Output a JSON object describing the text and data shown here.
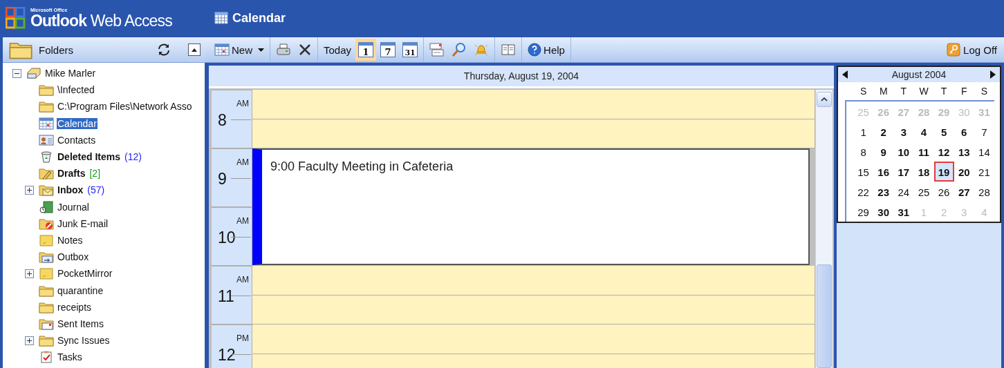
{
  "logo": {
    "suite": "Microsoft Office",
    "product": "**Outlook** Web Access"
  },
  "title": "Calendar",
  "folders": {
    "title": "Folders",
    "tree": [
      {
        "name": "Mike Marler",
        "kind": "mailbox",
        "expanded": true,
        "selected": false,
        "unread": false,
        "children": [
          {
            "name": "\\Infected",
            "kind": "folder",
            "selected": false,
            "unread": false
          },
          {
            "name": "C:\\Program Files\\Network Asso",
            "kind": "folder",
            "selected": false,
            "unread": false
          },
          {
            "name": "Calendar",
            "kind": "calendar",
            "selected": true,
            "unread": false
          },
          {
            "name": "Contacts",
            "kind": "contacts",
            "selected": false,
            "unread": false
          },
          {
            "name": "Deleted Items",
            "kind": "trash",
            "selected": false,
            "unread": true,
            "count": "(12)",
            "color": "#2020ff"
          },
          {
            "name": "Drafts",
            "kind": "drafts",
            "selected": false,
            "unread": true,
            "count": "[2]",
            "color": "#1a9a1a"
          },
          {
            "name": "Inbox",
            "kind": "inbox",
            "selected": false,
            "unread": true,
            "count": "(57)",
            "color": "#2020ff",
            "expanded": false
          },
          {
            "name": "Journal",
            "kind": "journal",
            "selected": false,
            "unread": false
          },
          {
            "name": "Junk E-mail",
            "kind": "junk",
            "selected": false,
            "unread": false
          },
          {
            "name": "Notes",
            "kind": "notes",
            "selected": false,
            "unread": false
          },
          {
            "name": "Outbox",
            "kind": "outbox",
            "selected": false,
            "unread": false
          },
          {
            "name": "PocketMirror",
            "kind": "notes",
            "selected": false,
            "unread": false,
            "expanded": false
          },
          {
            "name": "quarantine",
            "kind": "folder",
            "selected": false,
            "unread": false
          },
          {
            "name": "receipts",
            "kind": "folder",
            "selected": false,
            "unread": false
          },
          {
            "name": "Sent Items",
            "kind": "sent",
            "selected": false,
            "unread": false
          },
          {
            "name": "Sync Issues",
            "kind": "folder",
            "selected": false,
            "unread": false,
            "expanded": false
          },
          {
            "name": "Tasks",
            "kind": "tasks",
            "selected": false,
            "unread": false
          }
        ]
      }
    ]
  },
  "toolbar": {
    "groups": [
      [
        {
          "kind": "new",
          "label": "New"
        }
      ],
      [
        {
          "kind": "print"
        },
        {
          "kind": "delete"
        }
      ],
      [
        {
          "kind": "today",
          "label": "Today"
        },
        {
          "kind": "day",
          "label": "1",
          "selected": true
        },
        {
          "kind": "week",
          "label": "7",
          "selected": false
        },
        {
          "kind": "month",
          "label": "31",
          "selected": false
        }
      ],
      [
        {
          "kind": "options"
        },
        {
          "kind": "find"
        },
        {
          "kind": "reminders"
        }
      ],
      [
        {
          "kind": "addressbook"
        }
      ],
      [
        {
          "kind": "help",
          "label": "Help"
        }
      ]
    ],
    "logoff": "Log Off"
  },
  "day_view": {
    "date": "Thursday, August 19, 2004",
    "hours": [
      {
        "hour": "8",
        "period": "AM",
        "busy": false
      },
      {
        "hour": "9",
        "period": "AM",
        "busy": true,
        "appointment": "9:00 Faculty Meeting in Cafeteria"
      },
      {
        "hour": "10",
        "period": "AM",
        "busy": true
      },
      {
        "hour": "11",
        "period": "AM",
        "busy": false
      },
      {
        "hour": "12",
        "period": "PM",
        "busy": false
      }
    ]
  },
  "mini_calendar": {
    "month": "August 2004",
    "weekdays": [
      "S",
      "M",
      "T",
      "W",
      "T",
      "F",
      "S"
    ],
    "weeks": [
      [
        {
          "day": "25",
          "other_month": true,
          "has_items": false,
          "selected": false
        },
        {
          "day": "26",
          "other_month": true,
          "has_items": true,
          "selected": false
        },
        {
          "day": "27",
          "other_month": true,
          "has_items": true,
          "selected": false
        },
        {
          "day": "28",
          "other_month": true,
          "has_items": true,
          "selected": false
        },
        {
          "day": "29",
          "other_month": true,
          "has_items": true,
          "selected": false
        },
        {
          "day": "30",
          "other_month": true,
          "has_items": false,
          "selected": false
        },
        {
          "day": "31",
          "other_month": true,
          "has_items": true,
          "selected": false
        }
      ],
      [
        {
          "day": "1",
          "other_month": false,
          "has_items": false,
          "selected": false
        },
        {
          "day": "2",
          "other_month": false,
          "has_items": true,
          "selected": false
        },
        {
          "day": "3",
          "other_month": false,
          "has_items": true,
          "selected": false
        },
        {
          "day": "4",
          "other_month": false,
          "has_items": true,
          "selected": false
        },
        {
          "day": "5",
          "other_month": false,
          "has_items": true,
          "selected": false
        },
        {
          "day": "6",
          "other_month": false,
          "has_items": true,
          "selected": false
        },
        {
          "day": "7",
          "other_month": false,
          "has_items": false,
          "selected": false
        }
      ],
      [
        {
          "day": "8",
          "other_month": false,
          "has_items": false,
          "selected": false
        },
        {
          "day": "9",
          "other_month": false,
          "has_items": true,
          "selected": false
        },
        {
          "day": "10",
          "other_month": false,
          "has_items": true,
          "selected": false
        },
        {
          "day": "11",
          "other_month": false,
          "has_items": true,
          "selected": false
        },
        {
          "day": "12",
          "other_month": false,
          "has_items": true,
          "selected": false
        },
        {
          "day": "13",
          "other_month": false,
          "has_items": true,
          "selected": false
        },
        {
          "day": "14",
          "other_month": false,
          "has_items": false,
          "selected": false
        }
      ],
      [
        {
          "day": "15",
          "other_month": false,
          "has_items": false,
          "selected": false
        },
        {
          "day": "16",
          "other_month": false,
          "has_items": true,
          "selected": false
        },
        {
          "day": "17",
          "other_month": false,
          "has_items": true,
          "selected": false
        },
        {
          "day": "18",
          "other_month": false,
          "has_items": true,
          "selected": false
        },
        {
          "day": "19",
          "other_month": false,
          "has_items": true,
          "selected": true
        },
        {
          "day": "20",
          "other_month": false,
          "has_items": true,
          "selected": false
        },
        {
          "day": "21",
          "other_month": false,
          "has_items": false,
          "selected": false
        }
      ],
      [
        {
          "day": "22",
          "other_month": false,
          "has_items": false,
          "selected": false
        },
        {
          "day": "23",
          "other_month": false,
          "has_items": true,
          "selected": false
        },
        {
          "day": "24",
          "other_month": false,
          "has_items": false,
          "selected": false
        },
        {
          "day": "25",
          "other_month": false,
          "has_items": false,
          "selected": false
        },
        {
          "day": "26",
          "other_month": false,
          "has_items": false,
          "selected": false
        },
        {
          "day": "27",
          "other_month": false,
          "has_items": true,
          "selected": false
        },
        {
          "day": "28",
          "other_month": false,
          "has_items": false,
          "selected": false
        }
      ],
      [
        {
          "day": "29",
          "other_month": false,
          "has_items": false,
          "selected": false
        },
        {
          "day": "30",
          "other_month": false,
          "has_items": true,
          "selected": false
        },
        {
          "day": "31",
          "other_month": false,
          "has_items": true,
          "selected": false
        },
        {
          "day": "1",
          "other_month": true,
          "has_items": false,
          "selected": false
        },
        {
          "day": "2",
          "other_month": true,
          "has_items": false,
          "selected": false
        },
        {
          "day": "3",
          "other_month": true,
          "has_items": false,
          "selected": false
        },
        {
          "day": "4",
          "other_month": true,
          "has_items": false,
          "selected": false
        }
      ]
    ]
  }
}
